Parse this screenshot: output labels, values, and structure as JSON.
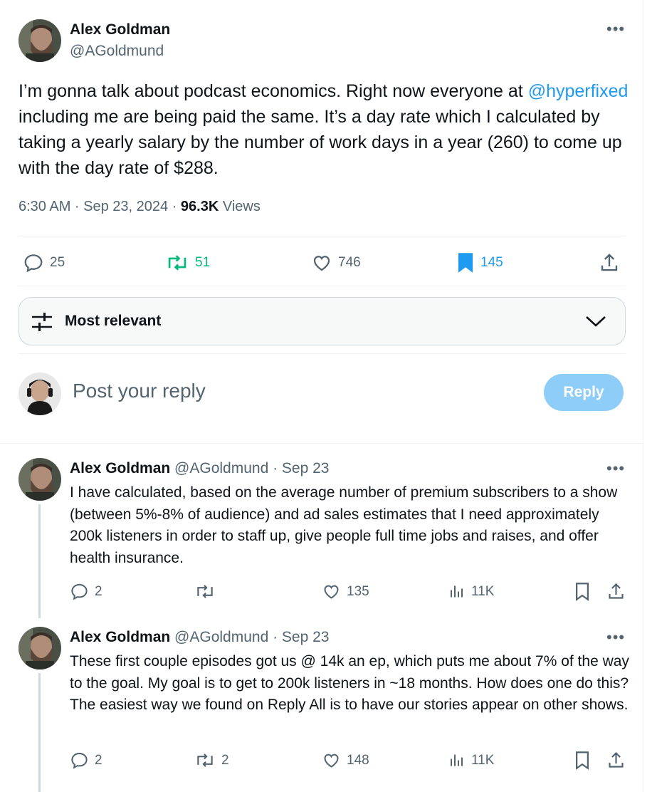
{
  "main_tweet": {
    "author_name": "Alex Goldman",
    "author_handle": "@AGoldmund",
    "text_before": "I’m gonna talk about podcast economics. Right now everyone at ",
    "mention": "@hyperfixed",
    "text_after": " including me are being paid the same. It’s a day rate which I calculated by taking a yearly salary by the number of work days in a year (260) to come up with the day rate of $288.",
    "time": "6:30 AM · Sep 23, 2024 · ",
    "views_count": "96.3K",
    "views_label": " Views",
    "stats": {
      "replies": "25",
      "reposts": "51",
      "likes": "746",
      "bookmarks": "145"
    }
  },
  "sort": {
    "label": "Most relevant"
  },
  "composer": {
    "placeholder": "Post your reply",
    "button_label": "Reply"
  },
  "replies": [
    {
      "name": "Alex Goldman",
      "handle": "@AGoldmund",
      "date": " · Sep 23",
      "text": "I have calculated, based on the average number of premium subscribers to a show (between 5%-8% of audience) and ad sales estimates that I need approximately 200k listeners in order to staff up, give people full time jobs and raises, and offer health insurance.",
      "replies": "2",
      "reposts": "",
      "likes": "135",
      "views": "11K"
    },
    {
      "name": "Alex Goldman",
      "handle": "@AGoldmund",
      "date": " · Sep 23",
      "text": "These first couple episodes got us @ 14k an ep, which puts me about 7% of the way to the goal. My goal is to get to 200k listeners in ~18 months. How does one do this? The easiest way we found on Reply All is to have our stories appear on other shows.",
      "replies": "2",
      "reposts": "2",
      "likes": "148",
      "views": "11K"
    }
  ],
  "colors": {
    "accent": "#1d9bf0",
    "repost_green": "#00ba7c",
    "muted": "#536471",
    "reply_button": "#8ecdf7"
  },
  "icons": [
    "more-icon",
    "reply-icon",
    "repost-icon",
    "like-icon",
    "bookmark-icon",
    "share-icon",
    "views-icon",
    "sort-icon",
    "chevron-down-icon"
  ]
}
